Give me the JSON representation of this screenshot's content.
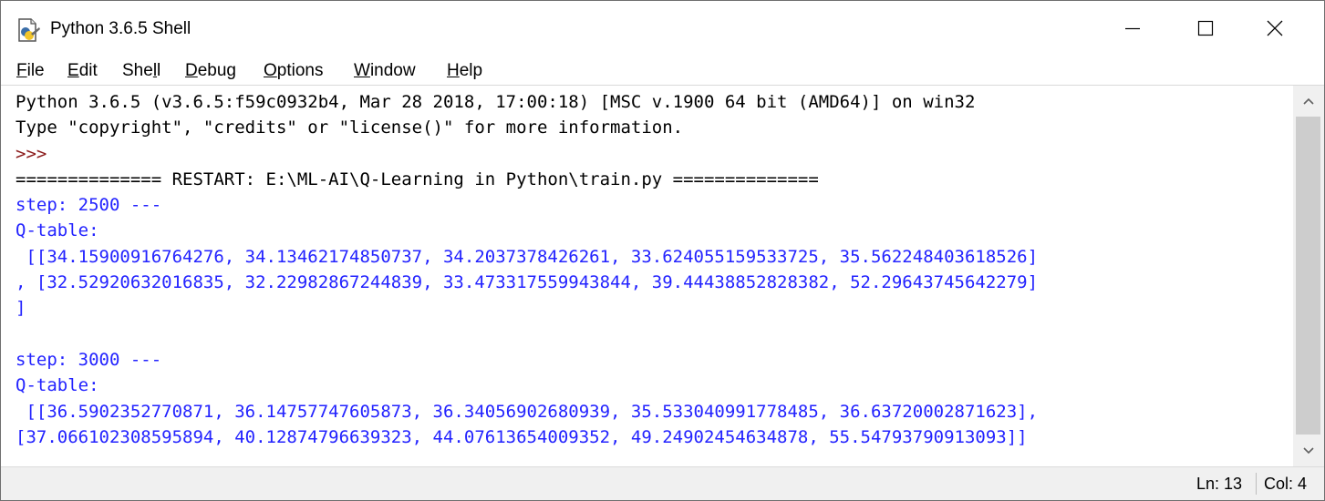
{
  "window": {
    "title": "Python 3.6.5 Shell",
    "icons": {
      "app": "python-idle-icon",
      "minimize": "minimize-icon",
      "maximize": "maximize-icon",
      "close": "close-icon"
    }
  },
  "menu": [
    {
      "key": "F",
      "rest": "ile"
    },
    {
      "key": "E",
      "rest": "dit"
    },
    {
      "pre": "She",
      "key": "l",
      "rest": "l"
    },
    {
      "key": "D",
      "rest": "ebug"
    },
    {
      "key": "O",
      "rest": "ptions"
    },
    {
      "key": "W",
      "rest": "indow"
    },
    {
      "key": "H",
      "rest": "elp"
    }
  ],
  "shell": {
    "lines": [
      {
        "text": "Python 3.6.5 (v3.6.5:f59c0932b4, Mar 28 2018, 17:00:18) [MSC v.1900 64 bit (AMD64)] on win32",
        "style": "stdout"
      },
      {
        "text": "Type \"copyright\", \"credits\" or \"license()\" for more information.",
        "style": "stdout"
      },
      {
        "text": ">>> ",
        "style": "prompt"
      },
      {
        "text": "============== RESTART: E:\\ML-AI\\Q-Learning in Python\\train.py ==============",
        "style": "stdout"
      },
      {
        "text": "step: 2500 ---",
        "style": "output"
      },
      {
        "text": "Q-table:",
        "style": "output"
      },
      {
        "text": " [[34.15900916764276, 34.13462174850737, 34.2037378426261, 33.624055159533725, 35.562248403618526]",
        "style": "output"
      },
      {
        "text": ", [32.52920632016835, 32.22982867244839, 33.473317559943844, 39.44438852828382, 52.29643745642279]",
        "style": "output"
      },
      {
        "text": "]",
        "style": "output"
      },
      {
        "text": "",
        "style": "output"
      },
      {
        "text": "step: 3000 ---",
        "style": "output"
      },
      {
        "text": "Q-table:",
        "style": "output"
      },
      {
        "text": " [[36.5902352770871, 36.14757747605873, 36.34056902680939, 35.533040991778485, 36.63720002871623],",
        "style": "output"
      },
      {
        "text": "[37.066102308595894, 40.12874796639323, 44.07613654009352, 49.24902454634878, 55.54793790913093]]",
        "style": "output"
      }
    ]
  },
  "scrollbar": {
    "up_icon": "scroll-up-arrow-icon",
    "down_icon": "scroll-down-arrow-icon"
  },
  "status": {
    "ln": "Ln: 13",
    "col": "Col: 4"
  },
  "colors": {
    "output": "#2323ff",
    "stdout": "#000000",
    "prompt": "#8b1a1a"
  }
}
